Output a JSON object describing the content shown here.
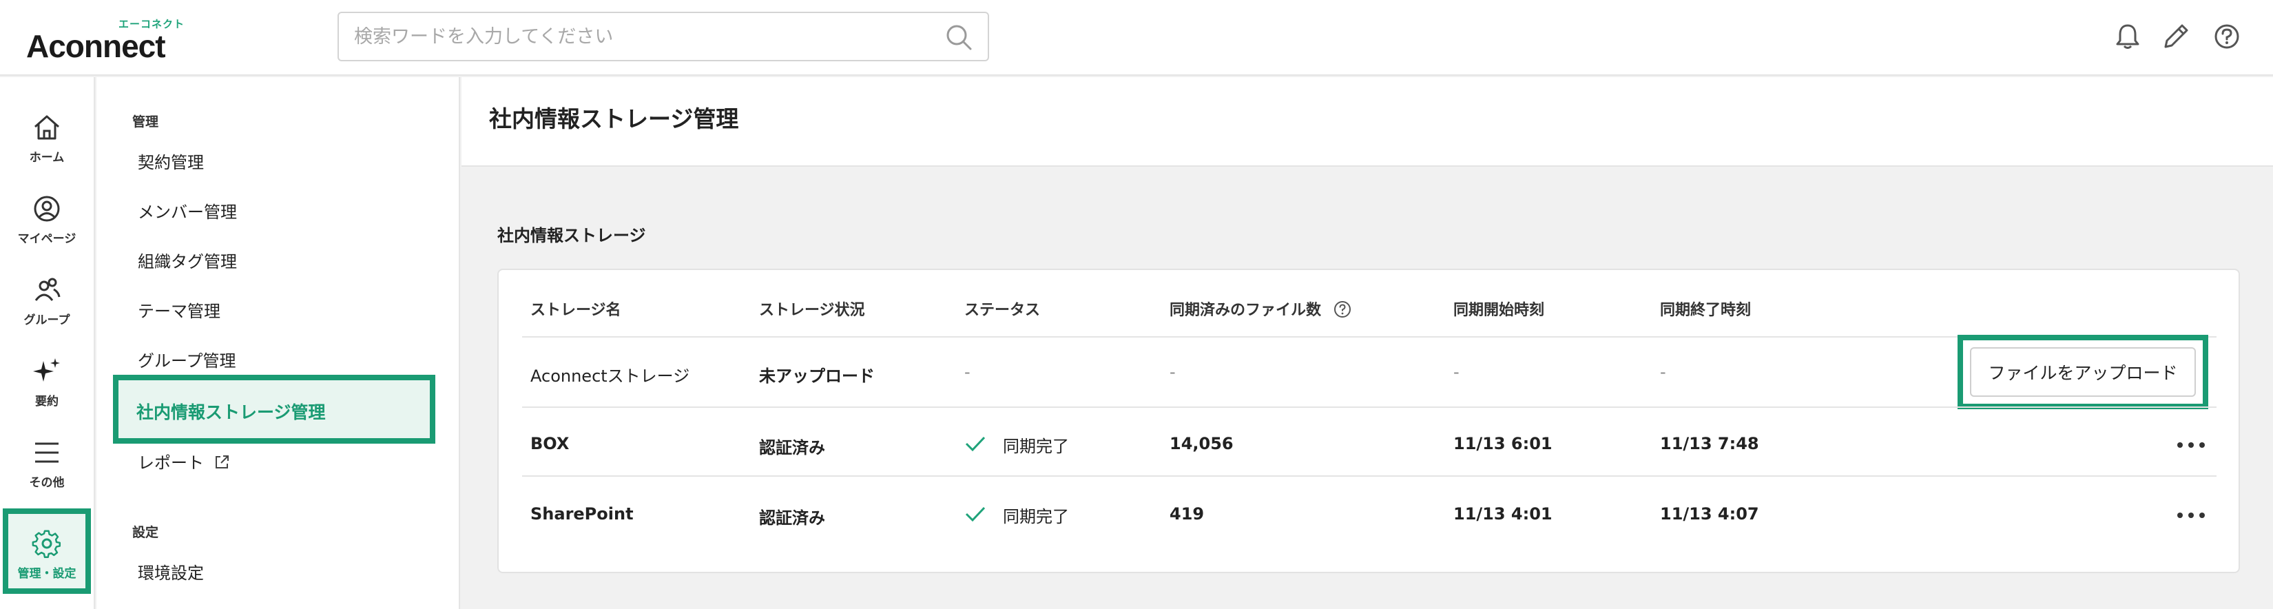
{
  "header": {
    "logo_kana": "エーコネクト",
    "logo_word": "Aconnect",
    "search_placeholder": "検索ワードを入力してください",
    "icons": [
      "bell-icon",
      "pen-icon",
      "help-icon"
    ]
  },
  "rail": {
    "items": [
      {
        "icon": "home-icon",
        "label": "ホーム"
      },
      {
        "icon": "user-circle-icon",
        "label": "マイページ"
      },
      {
        "icon": "group-icon",
        "label": "グループ"
      },
      {
        "icon": "sparkle-icon",
        "label": "要約"
      },
      {
        "icon": "menu-icon",
        "label": "その他"
      },
      {
        "icon": "gear-icon",
        "label": "管理・設定",
        "active": true
      }
    ]
  },
  "subnav": {
    "section1": "管理",
    "items": [
      "契約管理",
      "メンバー管理",
      "組織タグ管理",
      "テーマ管理",
      "グループ管理"
    ],
    "active": "社内情報ストレージ管理",
    "report": "レポート",
    "section2": "設定",
    "settings": "環境設定"
  },
  "main": {
    "page_title": "社内情報ストレージ管理",
    "section_title": "社内情報ストレージ"
  },
  "table": {
    "headers": [
      "ストレージ名",
      "ストレージ状況",
      "ステータス",
      "同期済みのファイル数",
      "同期開始時刻",
      "同期終了時刻"
    ],
    "rows": [
      {
        "name": "Aconnectストレージ",
        "state": "未アップロード",
        "status": "-",
        "files": "-",
        "start": "-",
        "end": "-",
        "action": "ファイルをアップロード"
      },
      {
        "name": "BOX",
        "state": "認証済み",
        "status": "同期完了",
        "files": "14,056",
        "start": "11/13 6:01",
        "end": "11/13 7:48"
      },
      {
        "name": "SharePoint",
        "state": "認証済み",
        "status": "同期完了",
        "files": "419",
        "start": "11/13 4:01",
        "end": "11/13 4:07"
      }
    ]
  },
  "colors": {
    "accent": "#1a9b73",
    "check": "#1fa37a"
  }
}
